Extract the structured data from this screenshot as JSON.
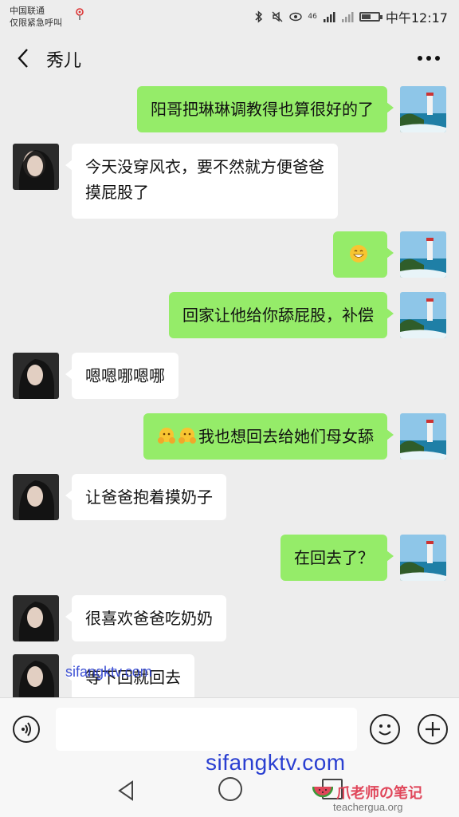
{
  "status_bar": {
    "carrier_line1": "中国联通",
    "carrier_line2": "仅限紧急呼叫",
    "network_label": "46",
    "time": "中午12:17",
    "battery_level": 0.55
  },
  "header": {
    "title": "秀儿",
    "back_icon": "chevron-left-icon",
    "more_icon": "more-dots-icon"
  },
  "messages": [
    {
      "side": "self",
      "text": "阳哥把琳琳调教得也算很好的了"
    },
    {
      "side": "other",
      "lines": [
        "今天没穿风衣，要不然就方便爸爸",
        "摸屁股了"
      ]
    },
    {
      "side": "self",
      "emoji": "grin-emoji-icon"
    },
    {
      "side": "self",
      "text": "回家让他给你舔屁股，补偿"
    },
    {
      "side": "other",
      "text": "嗯嗯哪嗯哪"
    },
    {
      "side": "self",
      "emojis": [
        "blush-hands-emoji-icon",
        "blush-hands-emoji-icon"
      ],
      "text": "我也想回去给她们母女舔"
    },
    {
      "side": "other",
      "text": "让爸爸抱着摸奶子"
    },
    {
      "side": "self",
      "text": "在回去了？"
    },
    {
      "side": "other",
      "text": "很喜欢爸爸吃奶奶"
    },
    {
      "side": "other",
      "text": "等下回就回去"
    }
  ],
  "input_bar": {
    "placeholder": "",
    "value": ""
  },
  "watermarks": {
    "mid": "sifangktv.com",
    "big": "sifangktv.com",
    "logo_text": "爪老师の笔记",
    "small": "teacherguа.org"
  },
  "colors": {
    "self_bubble": "#95ec69",
    "other_bubble": "#ffffff",
    "background": "#ededed"
  }
}
